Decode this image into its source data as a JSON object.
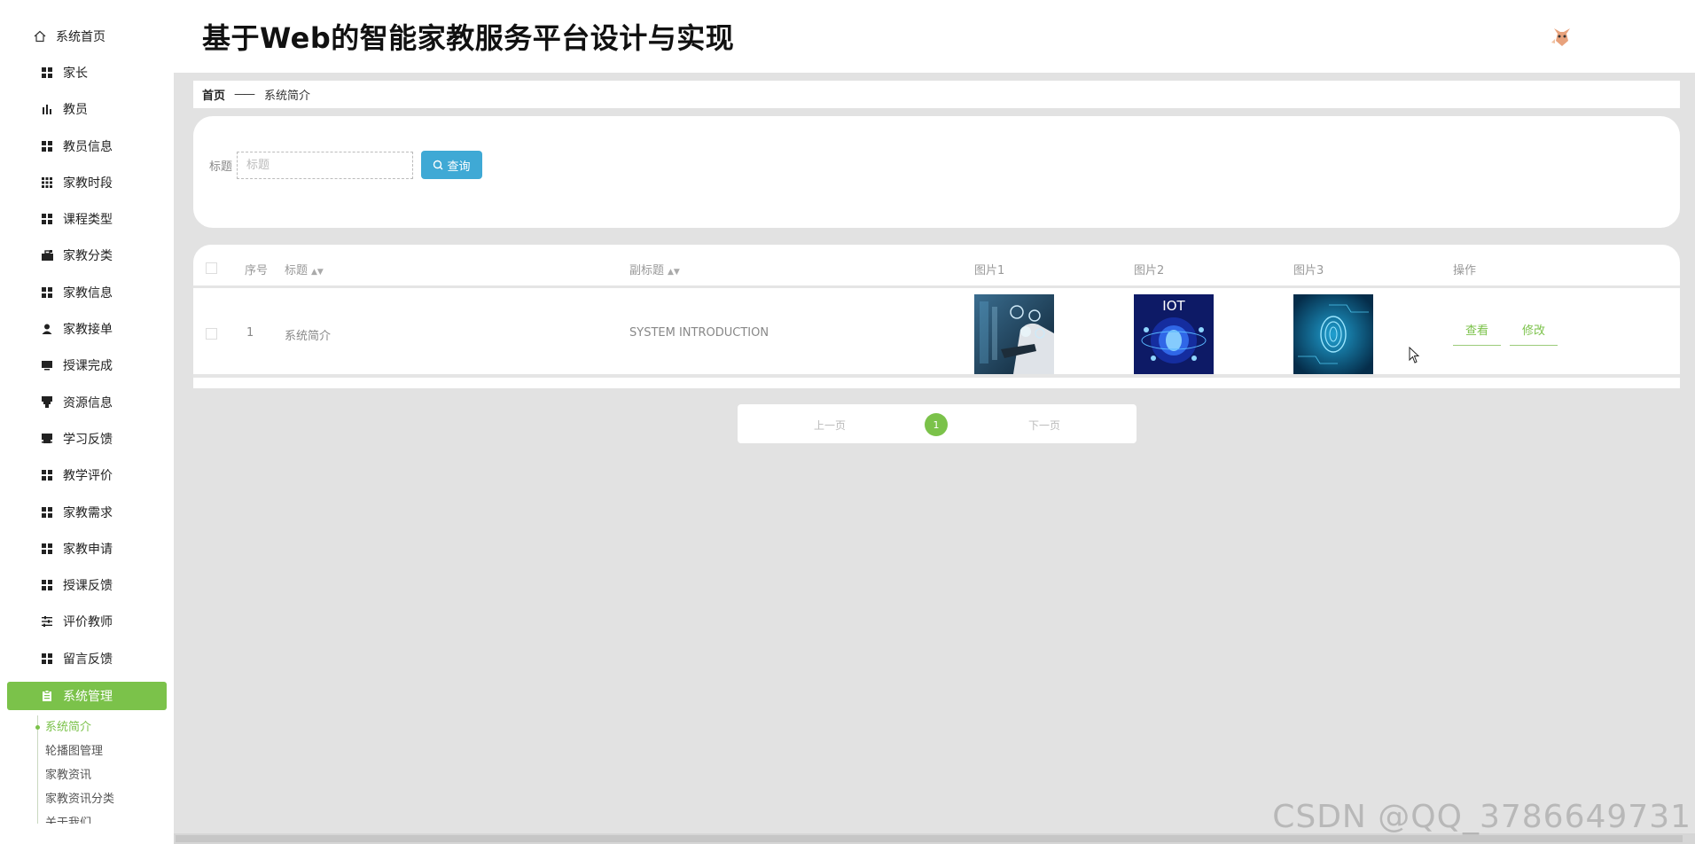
{
  "app": {
    "title": "基于Web的智能家教服务平台设计与实现"
  },
  "sidebar": {
    "home": {
      "label": "系统首页",
      "icon": "home-icon"
    },
    "items": [
      {
        "label": "家长",
        "icon": "grid-icon"
      },
      {
        "label": "教员",
        "icon": "bar-chart-icon"
      },
      {
        "label": "教员信息",
        "icon": "grid-icon"
      },
      {
        "label": "家教时段",
        "icon": "apps-icon"
      },
      {
        "label": "课程类型",
        "icon": "grid-icon"
      },
      {
        "label": "家教分类",
        "icon": "briefcase-icon"
      },
      {
        "label": "家教信息",
        "icon": "grid-icon"
      },
      {
        "label": "家教接单",
        "icon": "user-icon"
      },
      {
        "label": "授课完成",
        "icon": "monitor-icon"
      },
      {
        "label": "资源信息",
        "icon": "stamp-icon"
      },
      {
        "label": "学习反馈",
        "icon": "printer-icon"
      },
      {
        "label": "教学评价",
        "icon": "grid-icon"
      },
      {
        "label": "家教需求",
        "icon": "grid-icon"
      },
      {
        "label": "家教申请",
        "icon": "grid-icon"
      },
      {
        "label": "授课反馈",
        "icon": "grid-icon"
      },
      {
        "label": "评价教师",
        "icon": "sliders-icon"
      },
      {
        "label": "留言反馈",
        "icon": "grid-icon"
      }
    ],
    "active": {
      "label": "系统管理",
      "icon": "clipboard-icon"
    },
    "submenu": [
      "系统简介",
      "轮播图管理",
      "家教资讯",
      "家教资讯分类",
      "关于我们"
    ]
  },
  "breadcrumb": {
    "home": "首页",
    "sep": "——",
    "current": "系统简介"
  },
  "search": {
    "label": "标题",
    "placeholder": "标题",
    "value": "",
    "button": "查询"
  },
  "table": {
    "columns": [
      "序号",
      "标题",
      "副标题",
      "图片1",
      "图片2",
      "图片3",
      "操作"
    ],
    "rows": [
      {
        "index": "1",
        "title": "系统简介",
        "subtitle": "SYSTEM INTRODUCTION",
        "img2_text": "IOT",
        "actions": [
          "查看",
          "修改"
        ]
      }
    ]
  },
  "pager": {
    "prev": "上一页",
    "page": "1",
    "next": "下一页"
  },
  "watermark": "CSDN @QQ_3786649731",
  "colors": {
    "accent": "#7bc24a",
    "search_button": "#3fa9d5",
    "background": "#e2e2e2"
  }
}
